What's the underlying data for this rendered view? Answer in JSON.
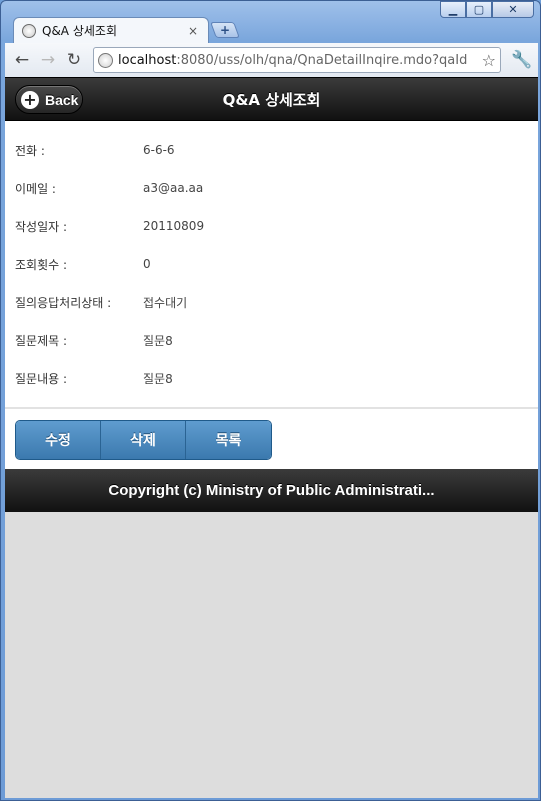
{
  "browser": {
    "tab_title": "Q&A 상세조회",
    "tab_close": "×",
    "new_tab": "+",
    "url_host": "localhost",
    "url_rest": ":8080/uss/olh/qna/QnaDetailInqire.mdo?qaId",
    "window_min": "▁",
    "window_max": "▢",
    "window_close": "✕"
  },
  "header": {
    "back_label": "Back",
    "title": "Q&A 상세조회"
  },
  "detail": {
    "rows": [
      {
        "label": "전화 :",
        "value": "6-6-6"
      },
      {
        "label": "이메일 :",
        "value": "a3@aa.aa"
      },
      {
        "label": "작성일자 :",
        "value": "20110809"
      },
      {
        "label": "조회횟수 :",
        "value": "0"
      },
      {
        "label": "질의응답처리상태 :",
        "value": "접수대기"
      },
      {
        "label": "질문제목 :",
        "value": "질문8"
      },
      {
        "label": "질문내용 :",
        "value": "질문8"
      }
    ]
  },
  "actions": {
    "edit": "수정",
    "delete": "삭제",
    "list": "목록"
  },
  "footer": {
    "text": "Copyright (c) Ministry of Public Administrati..."
  }
}
